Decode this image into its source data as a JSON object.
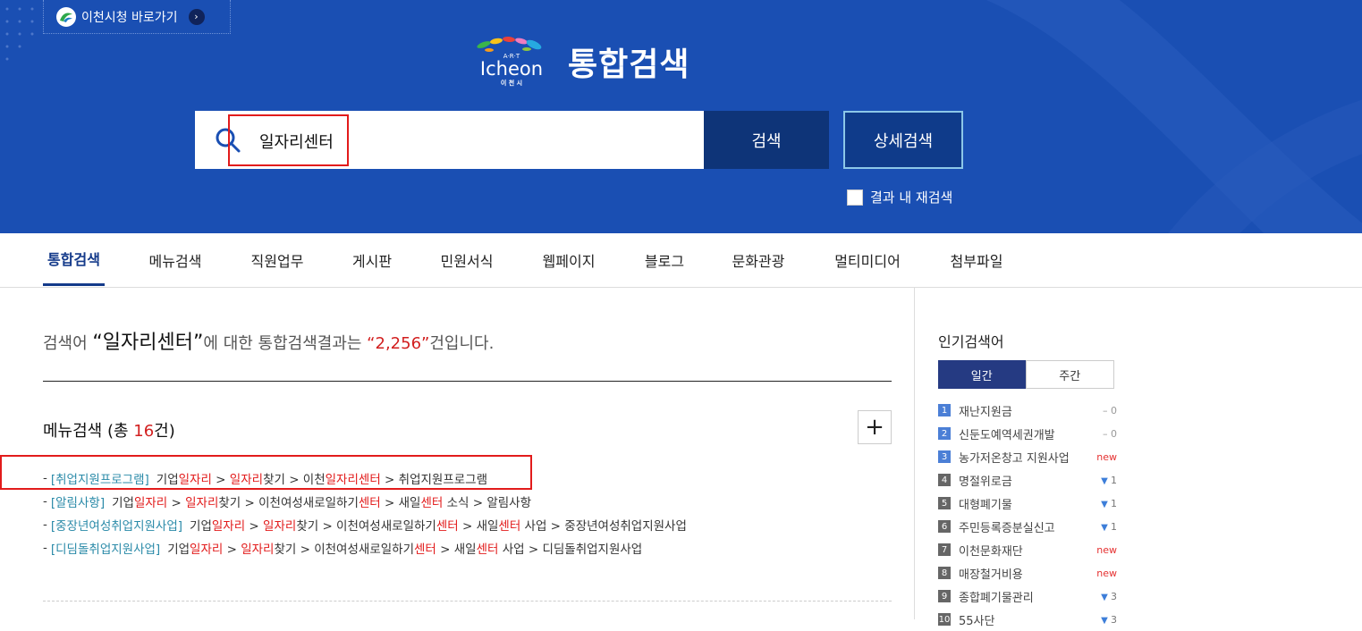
{
  "header": {
    "quicklink_label": "이천시청 바로가기",
    "brand_logo_text": "Icheon",
    "brand_logo_sub": "A·R·T",
    "brand_logo_city": "이 천 시",
    "title": "통합검색",
    "search_value": "일자리센터",
    "search_button": "검색",
    "detail_button": "상세검색",
    "research_label": "결과 내 재검색",
    "bg_color": "#1a4fb3"
  },
  "tabs": [
    {
      "label": "통합검색",
      "active": true
    },
    {
      "label": "메뉴검색"
    },
    {
      "label": "직원업무"
    },
    {
      "label": "게시판"
    },
    {
      "label": "민원서식"
    },
    {
      "label": "웹페이지"
    },
    {
      "label": "블로그"
    },
    {
      "label": "문화관광"
    },
    {
      "label": "멀티미디어"
    },
    {
      "label": "첨부파일"
    }
  ],
  "summary": {
    "prefix": "검색어 ",
    "keyword": "“일자리센터”",
    "middle": "에 대한 통합검색결과는 ",
    "count": "“2,256”",
    "suffix": "건입니다."
  },
  "menu_section": {
    "title_prefix": "메뉴검색 (총 ",
    "count": "16",
    "title_suffix": "건)",
    "more_label": "+",
    "results": [
      {
        "category": "[취업지원프로그램]",
        "segments": [
          [
            "기업",
            ""
          ],
          [
            "일자리",
            "hl"
          ],
          [
            " > ",
            ""
          ],
          [
            "일자리",
            "hl"
          ],
          [
            "찾기 > 이천",
            ""
          ],
          [
            "일자리센터",
            "hl"
          ],
          [
            " > 취업지원프로그램",
            ""
          ]
        ]
      },
      {
        "category": "[알림사항]",
        "segments": [
          [
            "기업",
            ""
          ],
          [
            "일자리",
            "hl"
          ],
          [
            " > ",
            ""
          ],
          [
            "일자리",
            "hl"
          ],
          [
            "찾기 > 이천여성새로일하기",
            ""
          ],
          [
            "센터",
            "hl"
          ],
          [
            " > 새일",
            ""
          ],
          [
            "센터",
            "hl"
          ],
          [
            " 소식 > 알림사항",
            ""
          ]
        ]
      },
      {
        "category": "[중장년여성취업지원사업]",
        "segments": [
          [
            "기업",
            ""
          ],
          [
            "일자리",
            "hl"
          ],
          [
            " > ",
            ""
          ],
          [
            "일자리",
            "hl"
          ],
          [
            "찾기 > 이천여성새로일하기",
            ""
          ],
          [
            "센터",
            "hl"
          ],
          [
            " > 새일",
            ""
          ],
          [
            "센터",
            "hl"
          ],
          [
            " 사업 > 중장년여성취업지원사업",
            ""
          ]
        ]
      },
      {
        "category": "[디딤돌취업지원사업]",
        "segments": [
          [
            "기업",
            ""
          ],
          [
            "일자리",
            "hl"
          ],
          [
            " > ",
            ""
          ],
          [
            "일자리",
            "hl"
          ],
          [
            "찾기 > 이천여성새로일하기",
            ""
          ],
          [
            "센터",
            "hl"
          ],
          [
            " > 새일",
            ""
          ],
          [
            "센터",
            "hl"
          ],
          [
            " 사업 > 디딤돌취업지원사업",
            ""
          ]
        ]
      }
    ]
  },
  "sidebar": {
    "title": "인기검색어",
    "period_tabs": [
      {
        "label": "일간",
        "active": true
      },
      {
        "label": "주간"
      }
    ],
    "popular": [
      {
        "rank": "1",
        "term": "재난지원금",
        "change": "– 0",
        "kind": "same"
      },
      {
        "rank": "2",
        "term": "신둔도예역세권개발",
        "change": "– 0",
        "kind": "same"
      },
      {
        "rank": "3",
        "term": "농가저온창고 지원사업",
        "change": "new",
        "kind": "new"
      },
      {
        "rank": "4",
        "term": "명절위로금",
        "change": "1",
        "kind": "down"
      },
      {
        "rank": "5",
        "term": "대형폐기물",
        "change": "1",
        "kind": "down"
      },
      {
        "rank": "6",
        "term": "주민등록증분실신고",
        "change": "1",
        "kind": "down"
      },
      {
        "rank": "7",
        "term": "이천문화재단",
        "change": "new",
        "kind": "new"
      },
      {
        "rank": "8",
        "term": "매장철거비용",
        "change": "new",
        "kind": "new"
      },
      {
        "rank": "9",
        "term": "종합폐기물관리",
        "change": "3",
        "kind": "down"
      },
      {
        "rank": "10",
        "term": "55사단",
        "change": "3",
        "kind": "down"
      }
    ]
  }
}
